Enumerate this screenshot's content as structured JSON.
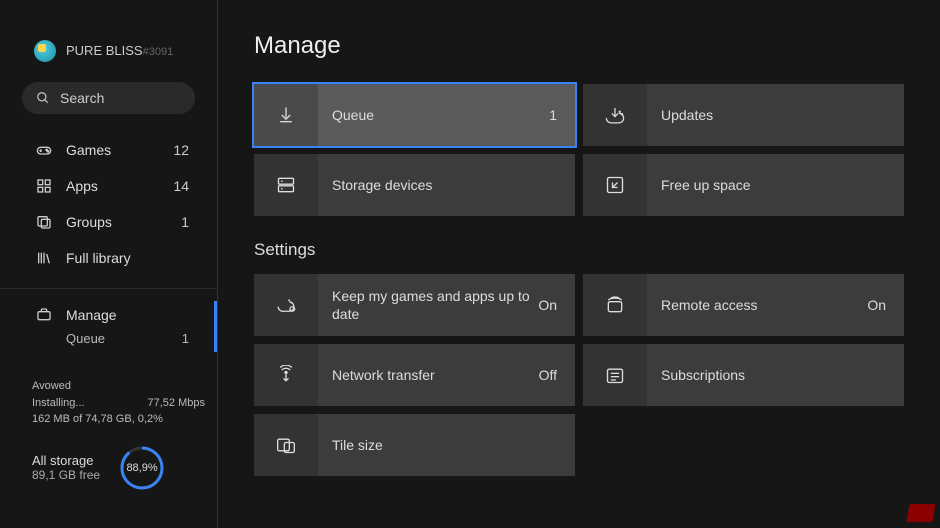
{
  "profile": {
    "name": "PURE BLISS",
    "tag": "#3091"
  },
  "search": {
    "placeholder": "Search"
  },
  "sidebar": {
    "items": [
      {
        "label": "Games",
        "count": "12"
      },
      {
        "label": "Apps",
        "count": "14"
      },
      {
        "label": "Groups",
        "count": "1"
      },
      {
        "label": "Full library"
      }
    ],
    "manage": {
      "label": "Manage",
      "sub": {
        "label": "Queue",
        "count": "1"
      }
    }
  },
  "install": {
    "title": "Avowed",
    "status": "Installing...",
    "speed": "77,52 Mbps",
    "progress": "162 MB of 74,78 GB, 0,2%"
  },
  "storage": {
    "label": "All storage",
    "free": "89,1 GB free",
    "percent": "88,9%",
    "percent_num": 88.9
  },
  "page": {
    "title": "Manage",
    "manage_tiles": [
      {
        "label": "Queue",
        "value": "1",
        "selected": true,
        "icon": "download"
      },
      {
        "label": "Updates",
        "icon": "updates"
      },
      {
        "label": "Storage devices",
        "icon": "storage"
      },
      {
        "label": "Free up space",
        "icon": "freeup"
      }
    ],
    "settings_title": "Settings",
    "settings_tiles": [
      {
        "label": "Keep my games and apps up to date",
        "value": "On",
        "icon": "keepupdate"
      },
      {
        "label": "Remote access",
        "value": "On",
        "icon": "remote"
      },
      {
        "label": "Network transfer",
        "value": "Off",
        "icon": "network"
      },
      {
        "label": "Subscriptions",
        "icon": "subscriptions"
      },
      {
        "label": "Tile size",
        "icon": "tilesize"
      }
    ]
  }
}
